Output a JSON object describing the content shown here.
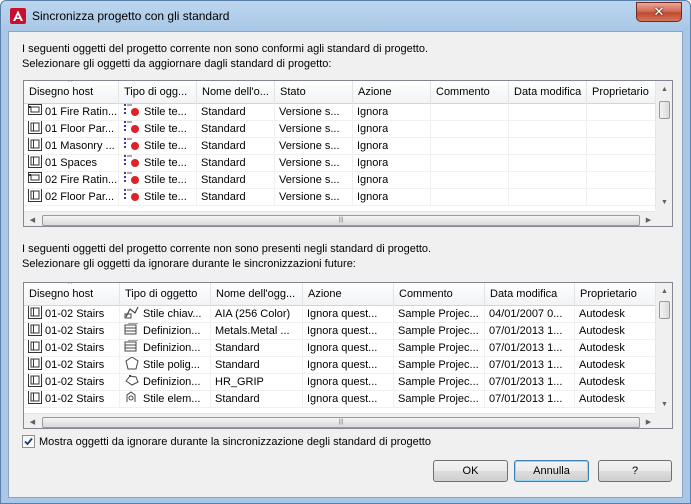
{
  "window": {
    "title": "Sincronizza progetto con gli standard",
    "close_label": "✕"
  },
  "section1": {
    "line1": "I seguenti oggetti del progetto corrente non sono conformi agli standard di progetto.",
    "line2": "Selezionare gli oggetti da aggiornare dagli standard di progetto:",
    "columns": [
      "Disegno host",
      "Tipo di ogg...",
      "Nome dell'o...",
      "Stato",
      "Azione",
      "Commento",
      "Data modifica",
      "Proprietario"
    ],
    "rows": [
      {
        "icon": "fire-rating-drawing-icon",
        "host": "01 Fire Ratin...",
        "type_icon": "style-red-icon",
        "type": "Stile te...",
        "name": "Standard",
        "state": "Versione s...",
        "action": "Ignora",
        "comment": "",
        "date": "",
        "owner": ""
      },
      {
        "icon": "floor-drawing-icon",
        "host": "01 Floor Par...",
        "type_icon": "style-red-icon",
        "type": "Stile te...",
        "name": "Standard",
        "state": "Versione s...",
        "action": "Ignora",
        "comment": "",
        "date": "",
        "owner": ""
      },
      {
        "icon": "floor-drawing-icon",
        "host": "01 Masonry ...",
        "type_icon": "style-red-icon",
        "type": "Stile te...",
        "name": "Standard",
        "state": "Versione s...",
        "action": "Ignora",
        "comment": "",
        "date": "",
        "owner": ""
      },
      {
        "icon": "floor-drawing-icon",
        "host": "01 Spaces",
        "type_icon": "style-red-icon",
        "type": "Stile te...",
        "name": "Standard",
        "state": "Versione s...",
        "action": "Ignora",
        "comment": "",
        "date": "",
        "owner": ""
      },
      {
        "icon": "fire-rating-drawing-icon",
        "host": "02 Fire Ratin...",
        "type_icon": "style-red-icon",
        "type": "Stile te...",
        "name": "Standard",
        "state": "Versione s...",
        "action": "Ignora",
        "comment": "",
        "date": "",
        "owner": ""
      },
      {
        "icon": "floor-drawing-icon",
        "host": "02 Floor Par...",
        "type_icon": "style-red-icon",
        "type": "Stile te...",
        "name": "Standard",
        "state": "Versione s...",
        "action": "Ignora",
        "comment": "",
        "date": "",
        "owner": ""
      }
    ]
  },
  "section2": {
    "line1": "I seguenti oggetti del progetto corrente non sono presenti negli standard di progetto.",
    "line2": "Selezionare gli oggetti da ignorare durante le sincronizzazioni future:",
    "columns": [
      "Disegno host",
      "Tipo di oggetto",
      "Nome dell'ogg...",
      "Azione",
      "Commento",
      "Data modifica",
      "Proprietario"
    ],
    "rows": [
      {
        "host": "01-02 Stairs",
        "type_icon": "key-style-icon",
        "type": "Stile chiav...",
        "name": "AIA (256 Color)",
        "action": "Ignora quest...",
        "comment": "Sample Projec...",
        "date": "04/01/2007 0...",
        "owner": "Autodesk"
      },
      {
        "host": "01-02 Stairs",
        "type_icon": "definition-icon",
        "type": "Definizion...",
        "name": "Metals.Metal ...",
        "action": "Ignora quest...",
        "comment": "Sample Projec...",
        "date": "07/01/2013 1...",
        "owner": "Autodesk"
      },
      {
        "host": "01-02 Stairs",
        "type_icon": "definition-icon",
        "type": "Definizion...",
        "name": "Standard",
        "action": "Ignora quest...",
        "comment": "Sample Projec...",
        "date": "07/01/2013 1...",
        "owner": "Autodesk"
      },
      {
        "host": "01-02 Stairs",
        "type_icon": "polygon-style-icon",
        "type": "Stile polig...",
        "name": "Standard",
        "action": "Ignora quest...",
        "comment": "Sample Projec...",
        "date": "07/01/2013 1...",
        "owner": "Autodesk"
      },
      {
        "host": "01-02 Stairs",
        "type_icon": "grip-definition-icon",
        "type": "Definizion...",
        "name": "HR_GRIP",
        "action": "Ignora quest...",
        "comment": "Sample Projec...",
        "date": "07/01/2013 1...",
        "owner": "Autodesk"
      },
      {
        "host": "01-02 Stairs",
        "type_icon": "element-style-icon",
        "type": "Stile elem...",
        "name": "Standard",
        "action": "Ignora quest...",
        "comment": "Sample Projec...",
        "date": "07/01/2013 1...",
        "owner": "Autodesk"
      }
    ]
  },
  "checkbox": {
    "label": "Mostra oggetti da ignorare durante la sincronizzazione degli standard di progetto",
    "checked": true
  },
  "buttons": {
    "ok": "OK",
    "cancel": "Annulla",
    "help": "?"
  }
}
